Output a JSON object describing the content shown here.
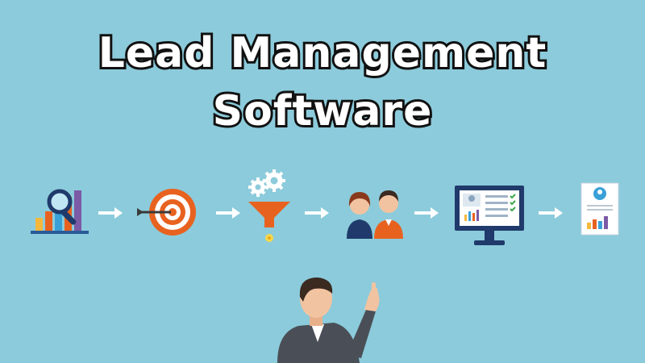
{
  "title": {
    "line1": "Lead Management",
    "line2": "Software"
  },
  "colors": {
    "background": "#8ccbdb",
    "accent_orange": "#e8621f",
    "navy": "#1f3a6b",
    "purple": "#7b5aa6"
  },
  "workflow": {
    "steps": [
      {
        "icon": "analytics-magnifier-icon"
      },
      {
        "icon": "target-arrow-icon"
      },
      {
        "icon": "gear-funnel-icon"
      },
      {
        "icon": "people-icon"
      },
      {
        "icon": "monitor-dashboard-icon"
      },
      {
        "icon": "report-document-icon"
      }
    ],
    "arrow_icon": "right-arrow-icon"
  },
  "figure": {
    "icon": "pointing-businessman"
  }
}
